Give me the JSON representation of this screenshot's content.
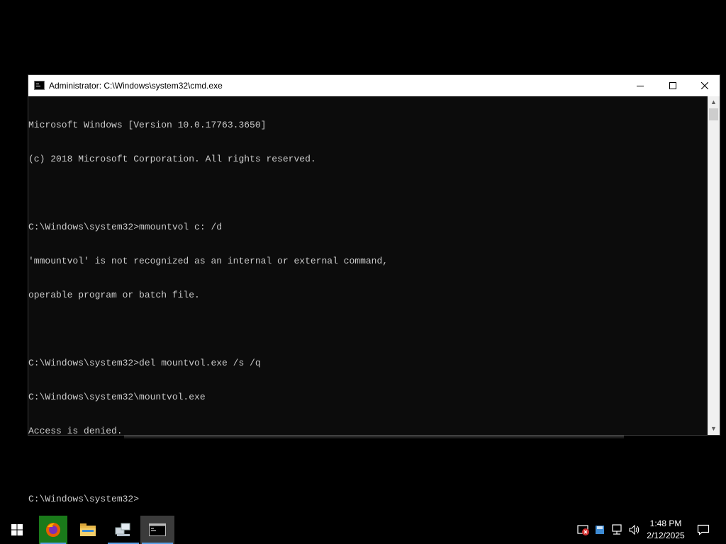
{
  "window": {
    "title": "Administrator: C:\\Windows\\system32\\cmd.exe",
    "console_lines": [
      "Microsoft Windows [Version 10.0.17763.3650]",
      "(c) 2018 Microsoft Corporation. All rights reserved.",
      "",
      "C:\\Windows\\system32>mmountvol c: /d",
      "'mmountvol' is not recognized as an internal or external command,",
      "operable program or batch file.",
      "",
      "C:\\Windows\\system32>del mountvol.exe /s /q",
      "C:\\Windows\\system32\\mountvol.exe",
      "Access is denied.",
      "",
      "C:\\Windows\\system32>"
    ]
  },
  "taskbar": {
    "apps": [
      "firefox-icon",
      "file-explorer-icon",
      "network-icon",
      "command-prompt-icon"
    ],
    "clock": {
      "time": "1:48 PM",
      "date": "2/12/2025"
    },
    "accent_color": "#5aa0e6"
  }
}
